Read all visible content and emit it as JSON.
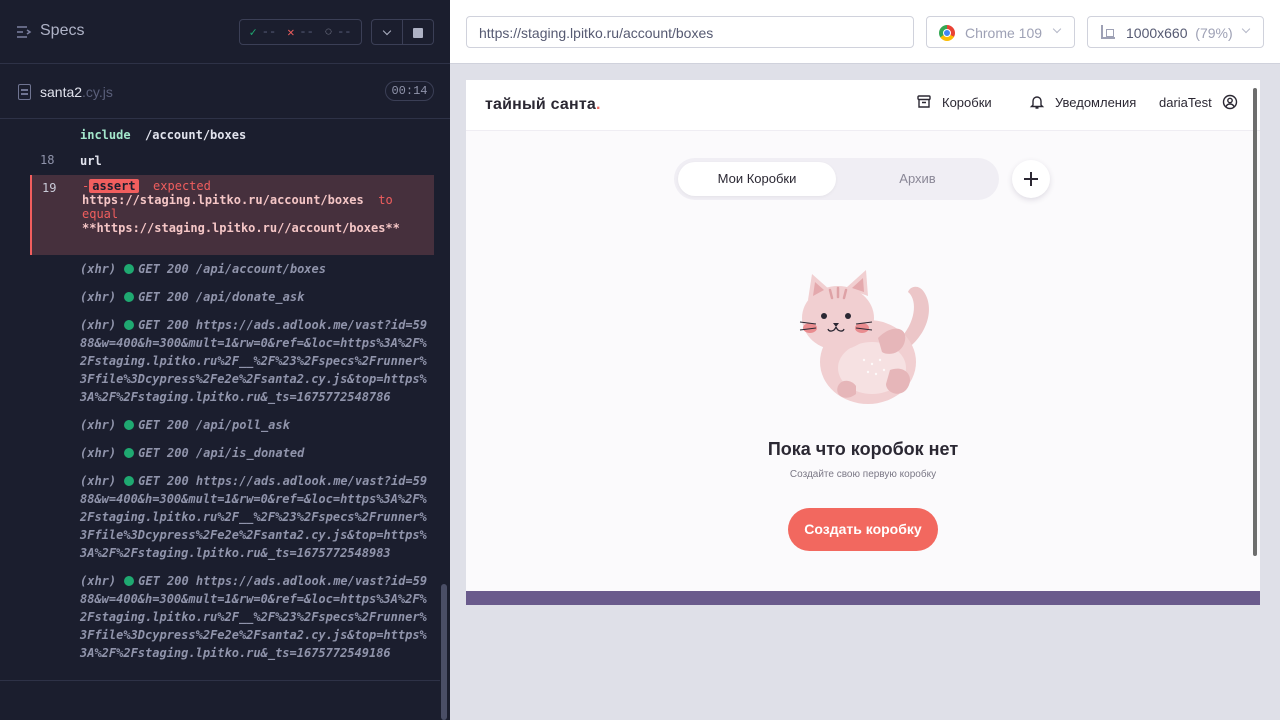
{
  "runner": {
    "specs_label": "Specs",
    "stats": {
      "passed": "--",
      "failed": "--",
      "pending": "--"
    },
    "file": {
      "name": "santa2",
      "ext": ".cy.js",
      "duration": "00:14"
    },
    "commands": [
      {
        "num": "",
        "name": "include",
        "arg": "/account/boxes"
      },
      {
        "num": "18",
        "name": "url"
      },
      {
        "num": "19",
        "prefix": "-",
        "tag": "assert",
        "word_expected": "expected",
        "actual": "https://staging.lpitko.ru/account/boxes",
        "word_to": "to",
        "word_equal": "equal",
        "expected": "**https://staging.lpitko.ru//account/boxes**"
      }
    ],
    "xhr": [
      {
        "label": "(xhr)",
        "text": "GET 200 /api/account/boxes"
      },
      {
        "label": "(xhr)",
        "text": "GET 200 /api/donate_ask"
      },
      {
        "label": "(xhr)",
        "text": "GET 200 https://ads.adlook.me/vast?id=5988&w=400&h=300&mult=1&rw=0&ref=&loc=https%3A%2F%2Fstaging.lpitko.ru%2F__%2F%23%2Fspecs%2Frunner%3Ffile%3Dcypress%2Fe2e%2Fsanta2.cy.js&top=https%3A%2F%2Fstaging.lpitko.ru&_ts=1675772548786"
      },
      {
        "label": "(xhr)",
        "text": "GET 200 /api/poll_ask"
      },
      {
        "label": "(xhr)",
        "text": "GET 200 /api/is_donated"
      },
      {
        "label": "(xhr)",
        "text": "GET 200 https://ads.adlook.me/vast?id=5988&w=400&h=300&mult=1&rw=0&ref=&loc=https%3A%2F%2Fstaging.lpitko.ru%2F__%2F%23%2Fspecs%2Frunner%3Ffile%3Dcypress%2Fe2e%2Fsanta2.cy.js&top=https%3A%2F%2Fstaging.lpitko.ru&_ts=1675772548983"
      },
      {
        "label": "(xhr)",
        "text": "GET 200 https://ads.adlook.me/vast?id=5988&w=400&h=300&mult=1&rw=0&ref=&loc=https%3A%2F%2Fstaging.lpitko.ru%2F__%2F%23%2Fspecs%2Frunner%3Ffile%3Dcypress%2Fe2e%2Fsanta2.cy.js&top=https%3A%2F%2Fstaging.lpitko.ru&_ts=1675772549186"
      }
    ]
  },
  "aut_bar": {
    "url": "https://staging.lpitko.ru/account/boxes",
    "browser": "Chrome 109",
    "viewport": "1000x660",
    "zoom": "(79%)"
  },
  "site": {
    "logo": "тайный санта",
    "logo_dot": ".",
    "nav": {
      "boxes": "Коробки",
      "notifications": "Уведомления",
      "user": "dariaTest"
    },
    "tabs": {
      "my": "Мои Коробки",
      "archive": "Архив"
    },
    "empty": {
      "title": "Пока что коробок нет",
      "subtitle": "Создайте свою первую коробку",
      "cta": "Создать коробку"
    }
  },
  "colors": {
    "accent": "#f2685f",
    "pass": "#1fa971",
    "fail": "#f15e5e",
    "footer": "#6a5b8c"
  },
  "icons": [
    "specs-icon",
    "check-icon",
    "cross-icon",
    "spinner-icon",
    "chevron-down-icon",
    "stop-icon",
    "file-icon",
    "chrome-icon",
    "viewport-icon",
    "box-icon",
    "bell-icon",
    "user-icon",
    "plus-icon",
    "cat-illustration"
  ]
}
